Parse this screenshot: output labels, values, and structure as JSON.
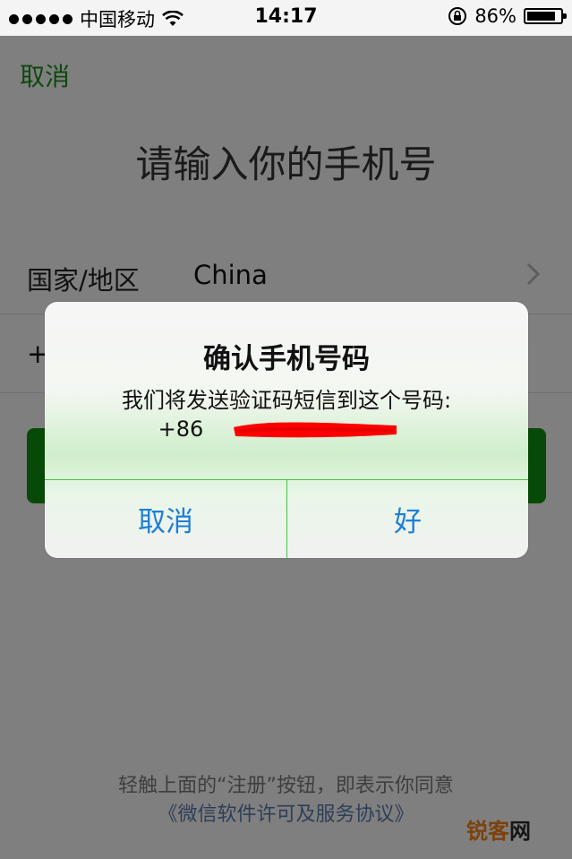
{
  "status_bar": {
    "carrier": "中国移动",
    "time": "14:17",
    "battery_percent": "86%",
    "battery_level": 0.86
  },
  "nav": {
    "cancel_label": "取消"
  },
  "page": {
    "title": "请输入你的手机号",
    "country_label": "国家/地区",
    "country_value": "China",
    "phone_prefix": "+",
    "agreement_text": "轻触上面的“注册”按钮，即表示你同意",
    "agreement_link": "《微信软件许可及服务协议》"
  },
  "dialog": {
    "title": "确认手机号码",
    "message": "我们将发送验证码短信到这个号码:",
    "number": "+86",
    "cancel_label": "取消",
    "ok_label": "好"
  },
  "watermark": {
    "part_orange": "锐客",
    "part_dark": "网"
  },
  "colors": {
    "accent_green": "#1b8a1b",
    "button_green": "#0f8f0f",
    "dialog_button_blue": "#1e7fd8",
    "redaction_red": "#ff0000"
  }
}
